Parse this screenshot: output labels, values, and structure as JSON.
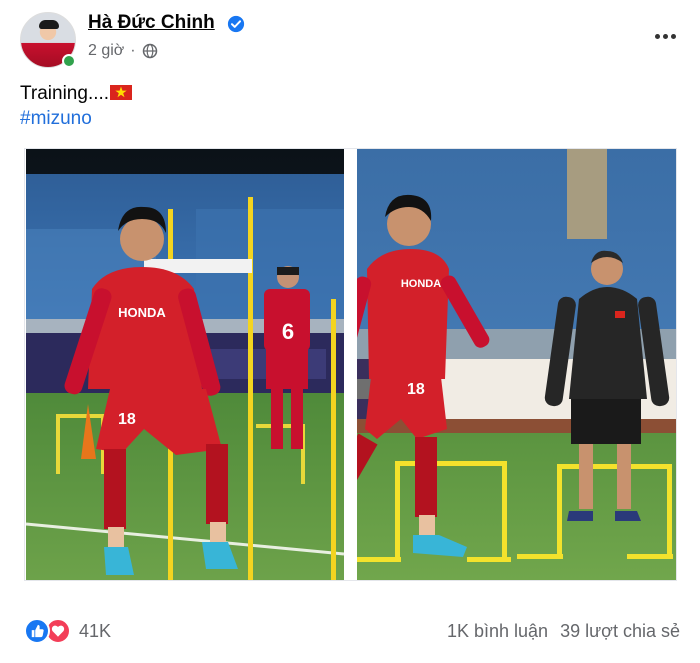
{
  "post": {
    "author": "Hà Đức Chinh",
    "time": "2 giờ",
    "text": "Training....",
    "hashtag": "#mizuno"
  },
  "photos": [
    {
      "jersey_number": "18",
      "jersey_text": "HONDA"
    },
    {
      "jersey_number": "18",
      "jersey_text": "HONDA",
      "bg_jersey_number": "6"
    }
  ],
  "footer": {
    "reaction_count": "41K",
    "comments": "1K bình luận",
    "shares": "39 lượt chia sẻ"
  },
  "colors": {
    "accent": "#216fdb",
    "like": "#1877f2",
    "love": "#f33e58",
    "jersey": "#c8102e"
  }
}
